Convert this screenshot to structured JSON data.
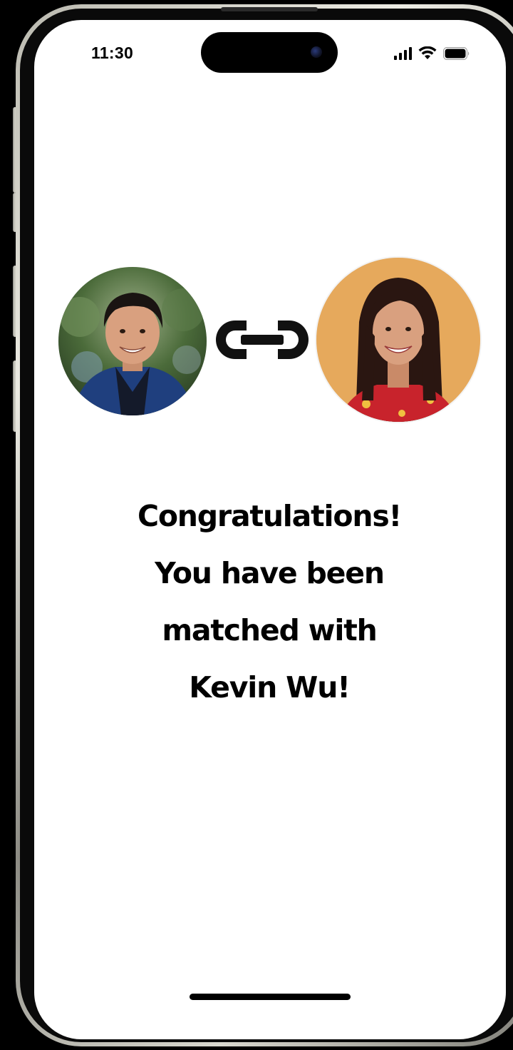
{
  "status_bar": {
    "time": "11:30",
    "icons": [
      "cellular-signal-icon",
      "wifi-icon",
      "battery-icon"
    ]
  },
  "match": {
    "left_avatar": "man-profile-photo",
    "right_avatar": "woman-profile-photo",
    "connector_icon": "link-icon",
    "right_avatar_background": "#E6A95C"
  },
  "message": {
    "line1": "Congratulations!",
    "line2": "You have been",
    "line3": "matched with",
    "line4": "Kevin Wu!"
  }
}
